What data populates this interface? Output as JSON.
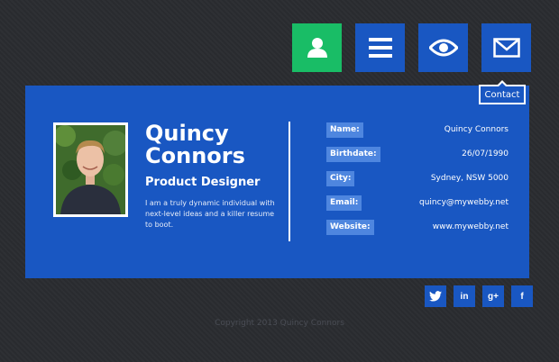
{
  "nav": {
    "items": [
      {
        "icon": "user-icon",
        "active": true
      },
      {
        "icon": "menu-icon",
        "active": false
      },
      {
        "icon": "eye-icon",
        "active": false
      },
      {
        "icon": "mail-icon",
        "active": false
      }
    ],
    "tooltip": "Contact"
  },
  "profile": {
    "name_first": "Quincy",
    "name_last": "Connors",
    "title": "Product Designer",
    "bio": "I am a truly dynamic individual with next-level ideas and a killer resume to boot."
  },
  "details": [
    {
      "label": "Name:",
      "value": "Quincy Connors"
    },
    {
      "label": "Birthdate:",
      "value": "26/07/1990"
    },
    {
      "label": "City:",
      "value": "Sydney, NSW 5000"
    },
    {
      "label": "Email:",
      "value": "quincy@mywebby.net"
    },
    {
      "label": "Website:",
      "value": "www.mywebby.net"
    }
  ],
  "social": [
    {
      "icon": "twitter-icon",
      "glyph": ""
    },
    {
      "icon": "linkedin-icon",
      "glyph": "in"
    },
    {
      "icon": "google-plus-icon",
      "glyph": "g+"
    },
    {
      "icon": "facebook-icon",
      "glyph": "f"
    }
  ],
  "footer": {
    "copyright": "Copyright 2013 Quincy Connors"
  },
  "colors": {
    "primary": "#1957c2",
    "accent": "#19bd66",
    "background": "#2b2d31",
    "label_bg": "#4e86df"
  }
}
